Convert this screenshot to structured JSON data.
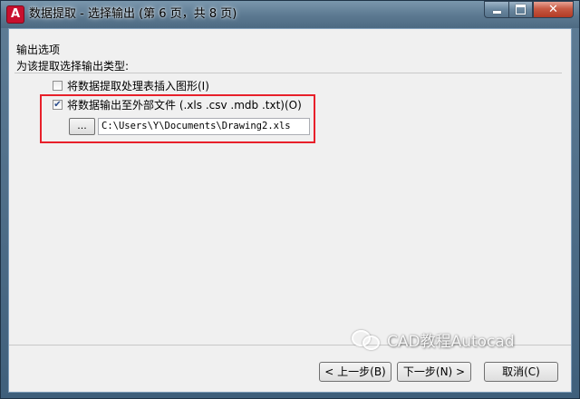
{
  "window": {
    "title": "数据提取 - 选择输出 (第 6 页，共 8 页)",
    "logo_letter": "A",
    "close_glyph": "✕"
  },
  "output_options": {
    "title": "输出选项",
    "subtitle": "为该提取选择输出类型:",
    "insert_table": {
      "label": "将数据提取处理表插入图形(I)",
      "checked": false
    },
    "external_file": {
      "label": "将数据输出至外部文件  (.xls .csv .mdb .txt)(O)",
      "checked": true,
      "check_glyph": "✔"
    },
    "browse_label": "...",
    "file_path": "C:\\Users\\Y\\Documents\\Drawing2.xls"
  },
  "buttons": {
    "back": "< 上一步(B)",
    "next": "下一步(N) >",
    "cancel": "取消(C)"
  },
  "watermark": {
    "text": "CAD教程Autocad"
  },
  "colors": {
    "highlight": "#e8202a",
    "title_bar": "#5b7890",
    "close_button": "#c75a44"
  }
}
